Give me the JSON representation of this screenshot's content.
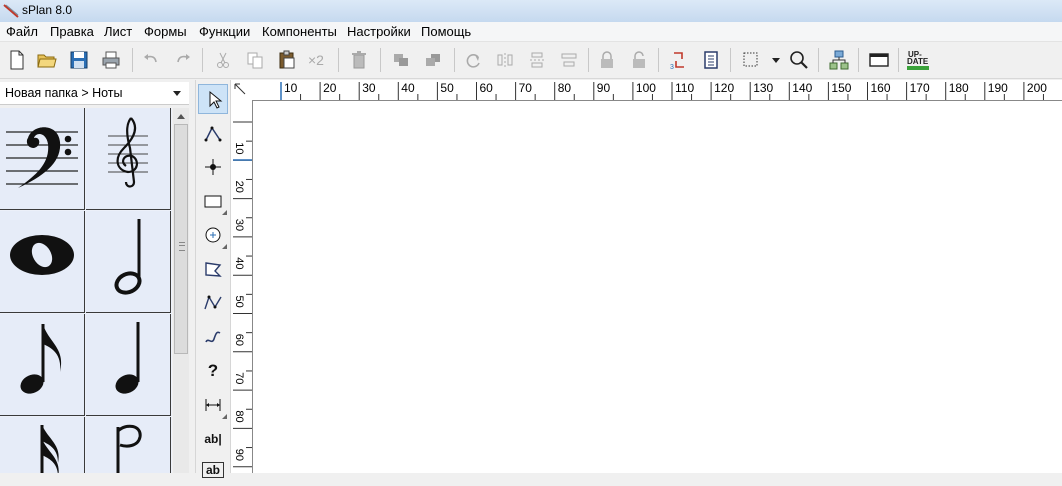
{
  "window": {
    "title": "sPlan 8.0"
  },
  "menu": [
    "Файл",
    "Правка",
    "Лист",
    "Формы",
    "Функции",
    "Компоненты",
    "Настройки",
    "Помощь"
  ],
  "toolbar": {
    "multiply_label": "×2",
    "update_label_line1": "UP-",
    "update_label_line2": "DATE"
  },
  "library": {
    "path": "Новая папка > Ноты",
    "items": [
      "bass-clef",
      "treble-clef",
      "whole-note",
      "half-note",
      "eighth-note",
      "quarter-note",
      "sixteenth-note",
      "half-note-flag"
    ]
  },
  "tools": {
    "question_label": "?",
    "text_label": "ab|",
    "text2_label": "ab"
  },
  "ruler": {
    "h": [
      "10",
      "20",
      "30",
      "40",
      "50",
      "60",
      "70",
      "80",
      "90",
      "100",
      "110",
      "120",
      "130",
      "140",
      "150",
      "160",
      "170",
      "180",
      "190",
      "200"
    ],
    "v": [
      "10",
      "20",
      "30",
      "40",
      "50",
      "60",
      "70",
      "80",
      "90"
    ]
  },
  "colors": {
    "accent": "#2b6fb5",
    "gallery_bg": "#e6ecf8",
    "selected_tool": "#cde3f7"
  }
}
